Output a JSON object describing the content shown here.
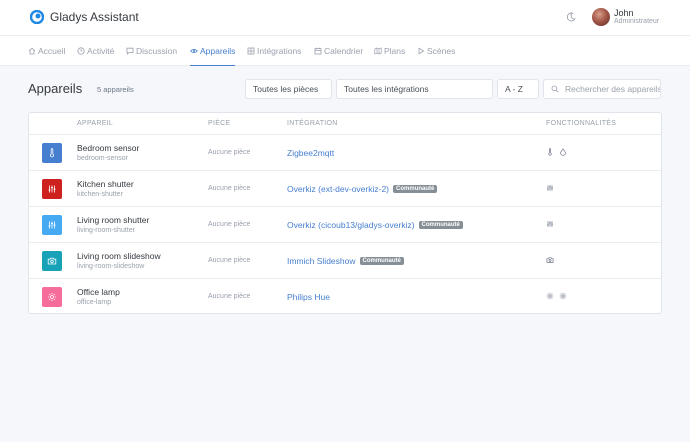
{
  "app": {
    "title": "Gladys Assistant"
  },
  "user": {
    "name": "John",
    "role": "Administrateur"
  },
  "nav": [
    {
      "label": "Accueil",
      "icon": "home-icon"
    },
    {
      "label": "Activité",
      "icon": "clock-icon"
    },
    {
      "label": "Discussion",
      "icon": "message-icon"
    },
    {
      "label": "Appareils",
      "icon": "eye-icon",
      "active": true
    },
    {
      "label": "Intégrations",
      "icon": "grid-icon"
    },
    {
      "label": "Calendrier",
      "icon": "calendar-icon"
    },
    {
      "label": "Plans",
      "icon": "map-icon"
    },
    {
      "label": "Scènes",
      "icon": "play-icon"
    }
  ],
  "page": {
    "title": "Appareils",
    "count": "5 appareils",
    "filters": {
      "rooms": "Toutes les pièces",
      "integrations": "Toutes les intégrations",
      "sort": "A - Z"
    },
    "search_placeholder": "Rechercher des appareils"
  },
  "table": {
    "headers": {
      "device": "APPAREIL",
      "room": "PIÈCE",
      "integration": "INTÉGRATION",
      "features": "FONCTIONNALITÉS"
    },
    "rows": [
      {
        "name": "Bedroom sensor",
        "selector": "bedroom-sensor",
        "room": "Aucune pièce",
        "integration": "Zigbee2mqtt",
        "badge": "",
        "icon": "thermometer-icon",
        "color": "#467fcf",
        "features": [
          "thermometer-icon",
          "droplet-icon"
        ]
      },
      {
        "name": "Kitchen shutter",
        "selector": "kitchen-shutter",
        "room": "Aucune pièce",
        "integration": "Overkiz (ext-dev-overkiz-2)",
        "badge": "Communauté",
        "icon": "sliders-icon",
        "color": "#cd201f",
        "features": [
          "sliders-icon"
        ]
      },
      {
        "name": "Living room shutter",
        "selector": "living-room-shutter",
        "room": "Aucune pièce",
        "integration": "Overkiz (cicoub13/gladys-overkiz)",
        "badge": "Communauté",
        "icon": "sliders-icon",
        "color": "#45aaf2",
        "features": [
          "sliders-icon"
        ]
      },
      {
        "name": "Living room slideshow",
        "selector": "living-room-slideshow",
        "room": "Aucune pièce",
        "integration": "Immich Slideshow",
        "badge": "Communauté",
        "icon": "camera-icon",
        "color": "#17a2b8",
        "features": [
          "camera-icon"
        ]
      },
      {
        "name": "Office lamp",
        "selector": "office-lamp",
        "room": "Aucune pièce",
        "integration": "Philips Hue",
        "badge": "",
        "icon": "sun-icon",
        "color": "#f66d9b",
        "features": [
          "sun-icon",
          "sun-icon"
        ]
      }
    ]
  },
  "colors": {
    "accent": "#467fcf"
  }
}
